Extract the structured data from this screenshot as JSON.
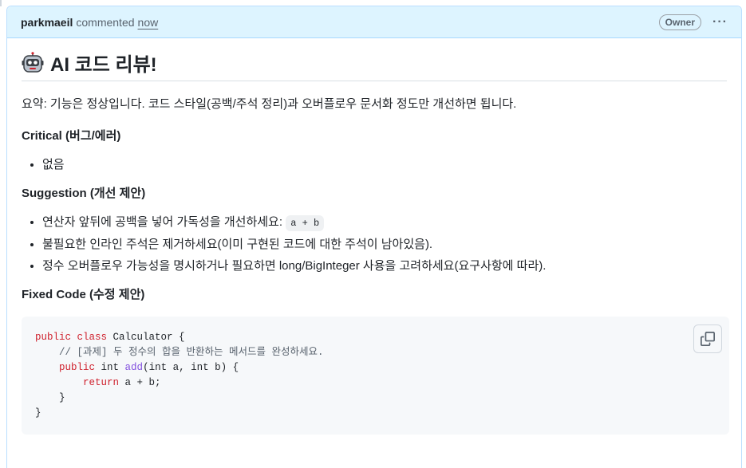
{
  "comment": {
    "author": "parkmaeil",
    "action": "commented",
    "time": "now",
    "badge": "Owner",
    "menu_glyph": "···"
  },
  "review": {
    "title": "AI 코드 리뷰!",
    "summary": "요약: 기능은 정상입니다. 코드 스타일(공백/주석 정리)과 오버플로우 문서화 정도만 개선하면 됩니다.",
    "critical_title": "Critical (버그/에러)",
    "critical_items": [
      "없음"
    ],
    "suggestion_title": "Suggestion (개선 제안)",
    "suggestion_1_text": "연산자 앞뒤에 공백을 넣어 가독성을 개선하세요: ",
    "suggestion_1_code": "a + b",
    "suggestion_2_text": "불필요한 인라인 주석은 제거하세요(이미 구현된 코드에 대한 주석이 남아있음).",
    "suggestion_3_text": "정수 오버플로우 가능성을 명시하거나 필요하면 long/BigInteger 사용을 고려하세요(요구사항에 따라).",
    "fixed_title": "Fixed Code (수정 제안)"
  },
  "code": {
    "l1_kw1": "public",
    "l1_kw2": "class",
    "l1_rest": " Calculator {",
    "l2_comment": "    // [과제] 두 정수의 합을 반환하는 메서드를 완성하세요.",
    "l3_indent": "    ",
    "l3_kw": "public",
    "l3_type": " int ",
    "l3_fn": "add",
    "l3_rest": "(int a, int b) {",
    "l4_indent": "        ",
    "l4_kw": "return",
    "l4_rest": " a + b;",
    "l5": "    }",
    "l6": "}"
  },
  "icons": {
    "header_icon": "robot-face-icon",
    "copy": "copy-icon"
  }
}
